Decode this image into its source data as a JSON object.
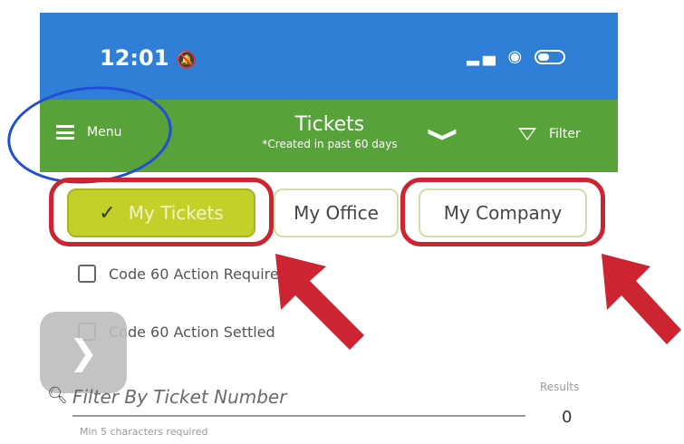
{
  "status_bar": {
    "time": "12:01",
    "bell_icon": "bell-icon",
    "signal_icon": "signal-icon",
    "wifi_icon": "wifi-icon",
    "battery_icon": "battery-icon"
  },
  "app_bar": {
    "menu_label": "Menu",
    "title": "Tickets",
    "subtitle": "*Created in past 60 days",
    "chevron": "❯",
    "filter_label": "Filter"
  },
  "tabs": [
    {
      "label": "My Tickets",
      "selected": true
    },
    {
      "label": "My Office",
      "selected": false
    },
    {
      "label": "My Company",
      "selected": false
    }
  ],
  "check_mark": "✓",
  "checkboxes": [
    {
      "label": "Code 60 Action Required",
      "checked": false
    },
    {
      "label": "Code 60 Action Settled",
      "checked": false
    }
  ],
  "fab_chevron": "❯",
  "search": {
    "placeholder": "Filter By Ticket Number",
    "helper": "Min 5 characters required",
    "search_icon": "search-icon"
  },
  "results": {
    "label": "Results",
    "count": "0"
  },
  "colors": {
    "status_bar": "#2f7fd6",
    "app_bar": "#58a23a",
    "selected_tab": "#c4d02a",
    "annotation_red": "#cc2430",
    "annotation_blue": "#1f4fd6"
  }
}
